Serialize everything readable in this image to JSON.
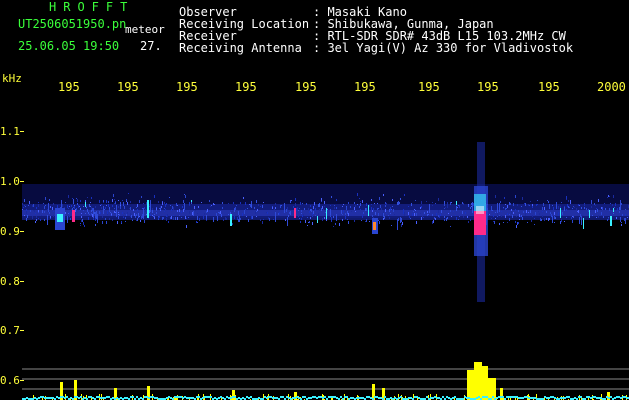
{
  "header": {
    "title": "HROFFT",
    "filename": "UT2506051950.pn",
    "meteor_label": "meteor",
    "datetime": "25.06.05 19:50",
    "count": "27.",
    "info": [
      {
        "label": "Observer",
        "value": ": Masaki Kano"
      },
      {
        "label": "Receiving Location",
        "value": ": Shibukawa, Gunma, Japan"
      },
      {
        "label": "Receiver",
        "value": ": RTL-SDR SDR# 43dB L15 103.2MHz CW"
      },
      {
        "label": "Receiving Antenna",
        "value": ": 3el Yagi(V) Az 330 for Vladivostok"
      }
    ]
  },
  "axes": {
    "y_unit": "kHz",
    "x_ticks": [
      "195",
      "195",
      "195",
      "195",
      "195",
      "195",
      "195",
      "195",
      "195",
      "2000"
    ],
    "y_ticks": [
      "1.1",
      "1.0",
      "0.9",
      "0.8",
      "0.7",
      "0.6"
    ]
  },
  "colors": {
    "header_green": "#3aff3a",
    "header_white": "#ffffff",
    "axis_yellow": "#ffff3a",
    "noise_blue": "#2233aa",
    "signal_magenta": "#ff2a8a",
    "signal_cyan": "#3af0ff",
    "level_yellow": "#ffff00"
  }
}
